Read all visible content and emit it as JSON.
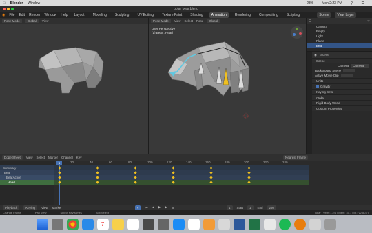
{
  "mac_menu": {
    "apple": "",
    "app": "Blender",
    "window": "Window",
    "battery": "28%",
    "clock": "Mon 2:23 PM"
  },
  "window_title": "polar bear.blend",
  "topbar": {
    "menus": [
      "File",
      "Edit",
      "Render",
      "Window",
      "Help"
    ],
    "workspaces": [
      "Layout",
      "Modeling",
      "Sculpting",
      "UV Editing",
      "Texture Paint",
      "Shading",
      "Animation",
      "Rendering",
      "Compositing",
      "Scripting"
    ],
    "active_workspace": "Animation",
    "scene": "Scene",
    "view_layer": "View Layer"
  },
  "left_viewport": {
    "mode": "Pose Mode",
    "orientation": "Global",
    "view": "View"
  },
  "main_viewport": {
    "mode": "Pose Mode",
    "view": "View",
    "select": "Select",
    "pose": "Pose",
    "orientation": "Global",
    "overlay_title": "User Perspective",
    "overlay_subtitle": "(1) Bear : Head"
  },
  "outliner": {
    "rows": [
      {
        "name": "Camera",
        "selected": false
      },
      {
        "name": "Empty",
        "selected": false
      },
      {
        "name": "Light",
        "selected": false
      },
      {
        "name": "Plane",
        "selected": false
      },
      {
        "name": "Bear",
        "selected": true
      }
    ]
  },
  "properties": {
    "scene_label": "Scene",
    "section_scene": "Scene",
    "camera_label": "Camera",
    "camera_value": "Camera",
    "bg_scene_label": "Background Scene",
    "active_clip_label": "Active Movie Clip",
    "units": "Units",
    "gravity": "Gravity",
    "keying_sets": "Keying Sets",
    "audio": "Audio",
    "rigid_body": "Rigid Body World",
    "custom_props": "Custom Properties"
  },
  "dopesheet": {
    "editor": "Dope Sheet",
    "menus": [
      "View",
      "Select",
      "Marker",
      "Channel",
      "Key"
    ],
    "keyframe_mode": "Nearest Frame",
    "ticks": [
      "0",
      "20",
      "40",
      "60",
      "80",
      "100",
      "120",
      "140",
      "160",
      "180",
      "200",
      "220",
      "240"
    ],
    "current_frame": "1",
    "channels": [
      {
        "name": "Summary"
      },
      {
        "name": "Bear"
      },
      {
        "name": "BearAction"
      },
      {
        "name": "Head"
      }
    ]
  },
  "playback": {
    "playback": "Playback",
    "keying": "Keying",
    "view": "View",
    "marker": "Marker",
    "frame": "1",
    "start_label": "Start",
    "start": "1",
    "end_label": "End",
    "end": "250"
  },
  "status": {
    "left": "Change Frame",
    "mid1": "Pan View",
    "mid2": "Select Keyframes",
    "mid3": "Box Select",
    "right": "Bear | Verts:1,2/4 | Mem: 40.1 MB | v2.80.75"
  },
  "colors": {
    "accent": "#4772b3",
    "keyframe": "#f0c020",
    "bone_selected": "#61c8e0"
  }
}
